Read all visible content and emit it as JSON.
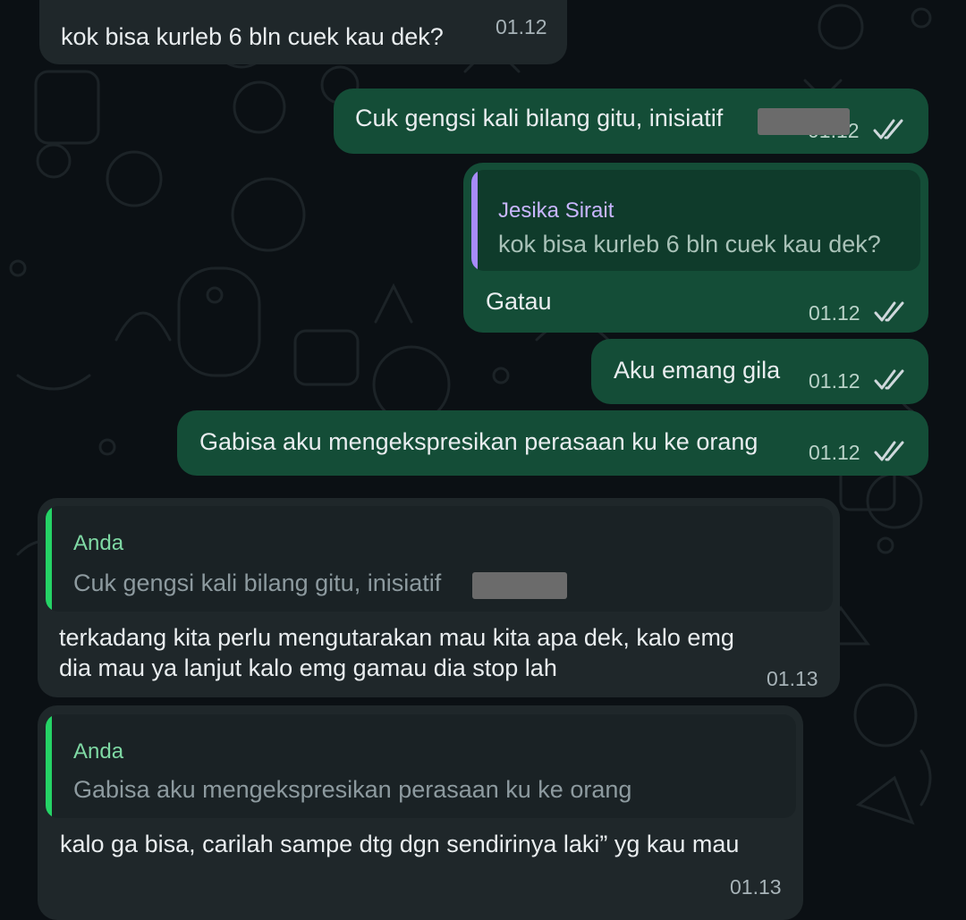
{
  "colors": {
    "outgoing_bubble": "#144d37",
    "incoming_bubble": "#1f272a",
    "quote_bar_purple": "#a78bfa",
    "quote_bar_green": "#25d366",
    "quote_name_green": "#7fd9a4",
    "read_ticks": "#cfd8dc"
  },
  "messages": [
    {
      "text": "kok bisa kurleb 6 bln cuek kau dek?",
      "time": "01.12"
    },
    {
      "text": "Cuk gengsi kali bilang gitu, inisiatif",
      "time": "01.12",
      "status_icon": "double-check-icon"
    },
    {
      "quote_name": "Jesika Sirait",
      "quote_text": "kok bisa kurleb 6 bln cuek kau dek?",
      "text": "Gatau",
      "time": "01.12",
      "status_icon": "double-check-icon"
    },
    {
      "text": "Aku emang gila",
      "time": "01.12",
      "status_icon": "double-check-icon"
    },
    {
      "text": "Gabisa aku mengekspresikan perasaan ku ke orang",
      "time": "01.12",
      "status_icon": "double-check-icon"
    },
    {
      "quote_name": "Anda",
      "quote_text": "Cuk gengsi kali bilang gitu, inisiatif",
      "text_line1": "terkadang kita perlu mengutarakan mau kita apa dek, kalo emg",
      "text_line2": "dia mau ya lanjut kalo emg gamau dia stop lah",
      "time": "01.13"
    },
    {
      "quote_name": "Anda",
      "quote_text": "Gabisa aku mengekspresikan perasaan ku ke orang",
      "text": "kalo ga bisa, carilah sampe dtg dgn sendirinya laki” yg kau mau",
      "time": "01.13"
    }
  ]
}
